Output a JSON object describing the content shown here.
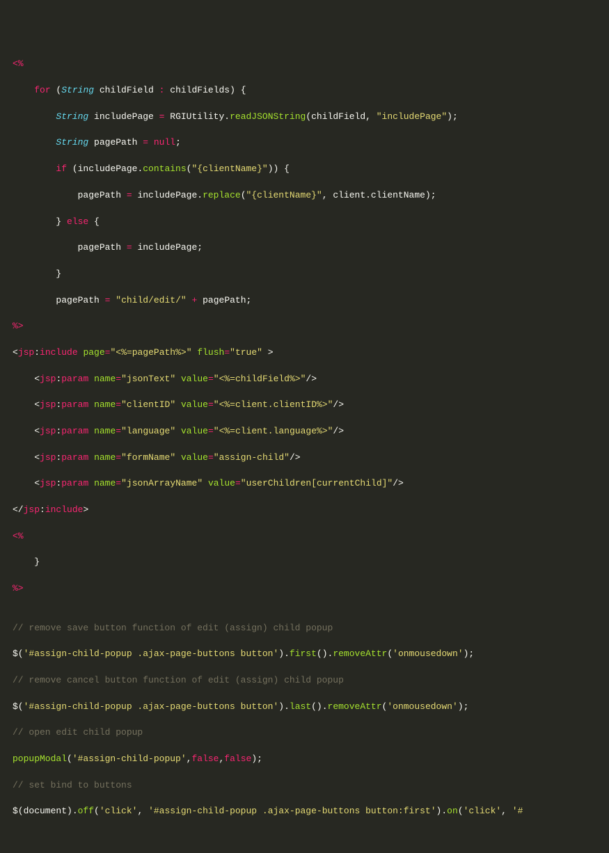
{
  "lines": [
    {
      "i": 0,
      "seg": [
        {
          "c": "jsptag",
          "t": "<%"
        }
      ]
    },
    {
      "i": 1,
      "seg": [
        {
          "c": "kw",
          "t": "for"
        },
        {
          "c": "id",
          "t": " ("
        },
        {
          "c": "type",
          "t": "String"
        },
        {
          "c": "id",
          "t": " childField "
        },
        {
          "c": "op",
          "t": ":"
        },
        {
          "c": "id",
          "t": " childFields) {"
        }
      ]
    },
    {
      "i": 2,
      "seg": [
        {
          "c": "type",
          "t": "String"
        },
        {
          "c": "id",
          "t": " includePage "
        },
        {
          "c": "op",
          "t": "="
        },
        {
          "c": "id",
          "t": " RGIUtility."
        },
        {
          "c": "fn",
          "t": "readJSONString"
        },
        {
          "c": "id",
          "t": "(childField, "
        },
        {
          "c": "str",
          "t": "\"includePage\""
        },
        {
          "c": "id",
          "t": ");"
        }
      ]
    },
    {
      "i": 2,
      "seg": [
        {
          "c": "type",
          "t": "String"
        },
        {
          "c": "id",
          "t": " pagePath "
        },
        {
          "c": "op",
          "t": "="
        },
        {
          "c": "id",
          "t": " "
        },
        {
          "c": "kw",
          "t": "null"
        },
        {
          "c": "id",
          "t": ";"
        }
      ]
    },
    {
      "i": 2,
      "seg": [
        {
          "c": "kw",
          "t": "if"
        },
        {
          "c": "id",
          "t": " (includePage."
        },
        {
          "c": "fn",
          "t": "contains"
        },
        {
          "c": "id",
          "t": "("
        },
        {
          "c": "str",
          "t": "\"{clientName}\""
        },
        {
          "c": "id",
          "t": ")) {"
        }
      ]
    },
    {
      "i": 3,
      "seg": [
        {
          "c": "id",
          "t": "pagePath "
        },
        {
          "c": "op",
          "t": "="
        },
        {
          "c": "id",
          "t": " includePage."
        },
        {
          "c": "fn",
          "t": "replace"
        },
        {
          "c": "id",
          "t": "("
        },
        {
          "c": "str",
          "t": "\"{clientName}\""
        },
        {
          "c": "id",
          "t": ", client.clientName);"
        }
      ]
    },
    {
      "i": 2,
      "seg": [
        {
          "c": "id",
          "t": "} "
        },
        {
          "c": "kw",
          "t": "else"
        },
        {
          "c": "id",
          "t": " {"
        }
      ]
    },
    {
      "i": 3,
      "seg": [
        {
          "c": "id",
          "t": "pagePath "
        },
        {
          "c": "op",
          "t": "="
        },
        {
          "c": "id",
          "t": " includePage;"
        }
      ]
    },
    {
      "i": 2,
      "seg": [
        {
          "c": "id",
          "t": "}"
        }
      ]
    },
    {
      "i": 2,
      "seg": [
        {
          "c": "id",
          "t": "pagePath "
        },
        {
          "c": "op",
          "t": "="
        },
        {
          "c": "id",
          "t": " "
        },
        {
          "c": "str",
          "t": "\"child/edit/\""
        },
        {
          "c": "id",
          "t": " "
        },
        {
          "c": "op",
          "t": "+"
        },
        {
          "c": "id",
          "t": " pagePath;"
        }
      ]
    },
    {
      "i": 0,
      "seg": [
        {
          "c": "jsptag",
          "t": "%>"
        }
      ]
    },
    {
      "i": 0,
      "seg": [
        {
          "c": "id",
          "t": "<"
        },
        {
          "c": "tag",
          "t": "jsp"
        },
        {
          "c": "id",
          "t": ":"
        },
        {
          "c": "tag",
          "t": "include"
        },
        {
          "c": "id",
          "t": " "
        },
        {
          "c": "attr",
          "t": "page"
        },
        {
          "c": "op",
          "t": "="
        },
        {
          "c": "str",
          "t": "\"<%=pagePath%>\""
        },
        {
          "c": "id",
          "t": " "
        },
        {
          "c": "attr",
          "t": "flush"
        },
        {
          "c": "op",
          "t": "="
        },
        {
          "c": "str",
          "t": "\"true\""
        },
        {
          "c": "id",
          "t": " >"
        }
      ]
    },
    {
      "i": 1,
      "seg": [
        {
          "c": "id",
          "t": "<"
        },
        {
          "c": "tag",
          "t": "jsp"
        },
        {
          "c": "id",
          "t": ":"
        },
        {
          "c": "tag",
          "t": "param"
        },
        {
          "c": "id",
          "t": " "
        },
        {
          "c": "attr",
          "t": "name"
        },
        {
          "c": "op",
          "t": "="
        },
        {
          "c": "str",
          "t": "\"jsonText\""
        },
        {
          "c": "id",
          "t": " "
        },
        {
          "c": "attr",
          "t": "value"
        },
        {
          "c": "op",
          "t": "="
        },
        {
          "c": "str",
          "t": "\"<%=childField%>\""
        },
        {
          "c": "id",
          "t": "/>"
        }
      ]
    },
    {
      "i": 1,
      "seg": [
        {
          "c": "id",
          "t": "<"
        },
        {
          "c": "tag",
          "t": "jsp"
        },
        {
          "c": "id",
          "t": ":"
        },
        {
          "c": "tag",
          "t": "param"
        },
        {
          "c": "id",
          "t": " "
        },
        {
          "c": "attr",
          "t": "name"
        },
        {
          "c": "op",
          "t": "="
        },
        {
          "c": "str",
          "t": "\"clientID\""
        },
        {
          "c": "id",
          "t": " "
        },
        {
          "c": "attr",
          "t": "value"
        },
        {
          "c": "op",
          "t": "="
        },
        {
          "c": "str",
          "t": "\"<%=client.clientID%>\""
        },
        {
          "c": "id",
          "t": "/>"
        }
      ]
    },
    {
      "i": 1,
      "seg": [
        {
          "c": "id",
          "t": "<"
        },
        {
          "c": "tag",
          "t": "jsp"
        },
        {
          "c": "id",
          "t": ":"
        },
        {
          "c": "tag",
          "t": "param"
        },
        {
          "c": "id",
          "t": " "
        },
        {
          "c": "attr",
          "t": "name"
        },
        {
          "c": "op",
          "t": "="
        },
        {
          "c": "str",
          "t": "\"language\""
        },
        {
          "c": "id",
          "t": " "
        },
        {
          "c": "attr",
          "t": "value"
        },
        {
          "c": "op",
          "t": "="
        },
        {
          "c": "str",
          "t": "\"<%=client.language%>\""
        },
        {
          "c": "id",
          "t": "/>"
        }
      ]
    },
    {
      "i": 1,
      "seg": [
        {
          "c": "id",
          "t": "<"
        },
        {
          "c": "tag",
          "t": "jsp"
        },
        {
          "c": "id",
          "t": ":"
        },
        {
          "c": "tag",
          "t": "param"
        },
        {
          "c": "id",
          "t": " "
        },
        {
          "c": "attr",
          "t": "name"
        },
        {
          "c": "op",
          "t": "="
        },
        {
          "c": "str",
          "t": "\"formName\""
        },
        {
          "c": "id",
          "t": " "
        },
        {
          "c": "attr",
          "t": "value"
        },
        {
          "c": "op",
          "t": "="
        },
        {
          "c": "str",
          "t": "\"assign-child\""
        },
        {
          "c": "id",
          "t": "/>"
        }
      ]
    },
    {
      "i": 1,
      "seg": [
        {
          "c": "id",
          "t": "<"
        },
        {
          "c": "tag",
          "t": "jsp"
        },
        {
          "c": "id",
          "t": ":"
        },
        {
          "c": "tag",
          "t": "param"
        },
        {
          "c": "id",
          "t": " "
        },
        {
          "c": "attr",
          "t": "name"
        },
        {
          "c": "op",
          "t": "="
        },
        {
          "c": "str",
          "t": "\"jsonArrayName\""
        },
        {
          "c": "id",
          "t": " "
        },
        {
          "c": "attr",
          "t": "value"
        },
        {
          "c": "op",
          "t": "="
        },
        {
          "c": "str",
          "t": "\"userChildren[currentChild]\""
        },
        {
          "c": "id",
          "t": "/>"
        }
      ]
    },
    {
      "i": 0,
      "seg": [
        {
          "c": "id",
          "t": "</"
        },
        {
          "c": "tag",
          "t": "jsp"
        },
        {
          "c": "id",
          "t": ":"
        },
        {
          "c": "tag",
          "t": "include"
        },
        {
          "c": "id",
          "t": ">"
        }
      ]
    },
    {
      "i": 0,
      "seg": [
        {
          "c": "jsptag",
          "t": "<%"
        }
      ]
    },
    {
      "i": 1,
      "seg": [
        {
          "c": "id",
          "t": "}"
        }
      ]
    },
    {
      "i": 0,
      "seg": [
        {
          "c": "jsptag",
          "t": "%>"
        }
      ]
    },
    {
      "i": 0,
      "seg": [
        {
          "c": "id",
          "t": ""
        }
      ]
    },
    {
      "i": 0,
      "seg": [
        {
          "c": "cmt",
          "t": "// remove save button function of edit (assign) child popup"
        }
      ]
    },
    {
      "i": 0,
      "seg": [
        {
          "c": "id",
          "t": "$("
        },
        {
          "c": "str",
          "t": "'#assign-child-popup .ajax-page-buttons button'"
        },
        {
          "c": "id",
          "t": ")."
        },
        {
          "c": "fn",
          "t": "first"
        },
        {
          "c": "id",
          "t": "()."
        },
        {
          "c": "fn",
          "t": "removeAttr"
        },
        {
          "c": "id",
          "t": "("
        },
        {
          "c": "str",
          "t": "'onmousedown'"
        },
        {
          "c": "id",
          "t": ");"
        }
      ]
    },
    {
      "i": 0,
      "seg": [
        {
          "c": "cmt",
          "t": "// remove cancel button function of edit (assign) child popup"
        }
      ]
    },
    {
      "i": 0,
      "seg": [
        {
          "c": "id",
          "t": "$("
        },
        {
          "c": "str",
          "t": "'#assign-child-popup .ajax-page-buttons button'"
        },
        {
          "c": "id",
          "t": ")."
        },
        {
          "c": "fn",
          "t": "last"
        },
        {
          "c": "id",
          "t": "()."
        },
        {
          "c": "fn",
          "t": "removeAttr"
        },
        {
          "c": "id",
          "t": "("
        },
        {
          "c": "str",
          "t": "'onmousedown'"
        },
        {
          "c": "id",
          "t": ");"
        }
      ]
    },
    {
      "i": 0,
      "seg": [
        {
          "c": "cmt",
          "t": "// open edit child popup"
        }
      ]
    },
    {
      "i": 0,
      "seg": [
        {
          "c": "fn",
          "t": "popupModal"
        },
        {
          "c": "id",
          "t": "("
        },
        {
          "c": "str",
          "t": "'#assign-child-popup'"
        },
        {
          "c": "id",
          "t": ","
        },
        {
          "c": "kw",
          "t": "false"
        },
        {
          "c": "id",
          "t": ","
        },
        {
          "c": "kw",
          "t": "false"
        },
        {
          "c": "id",
          "t": ");"
        }
      ]
    },
    {
      "i": 0,
      "seg": [
        {
          "c": "cmt",
          "t": "// set bind to buttons"
        }
      ]
    },
    {
      "i": 0,
      "seg": [
        {
          "c": "id",
          "t": "$(document)."
        },
        {
          "c": "fn",
          "t": "off"
        },
        {
          "c": "id",
          "t": "("
        },
        {
          "c": "str",
          "t": "'click'"
        },
        {
          "c": "id",
          "t": ", "
        },
        {
          "c": "str",
          "t": "'#assign-child-popup .ajax-page-buttons button:first'"
        },
        {
          "c": "id",
          "t": ")."
        },
        {
          "c": "fn",
          "t": "on"
        },
        {
          "c": "id",
          "t": "("
        },
        {
          "c": "str",
          "t": "'click'"
        },
        {
          "c": "id",
          "t": ", "
        },
        {
          "c": "str",
          "t": "'#"
        }
      ]
    }
  ],
  "indent_unit": "    "
}
